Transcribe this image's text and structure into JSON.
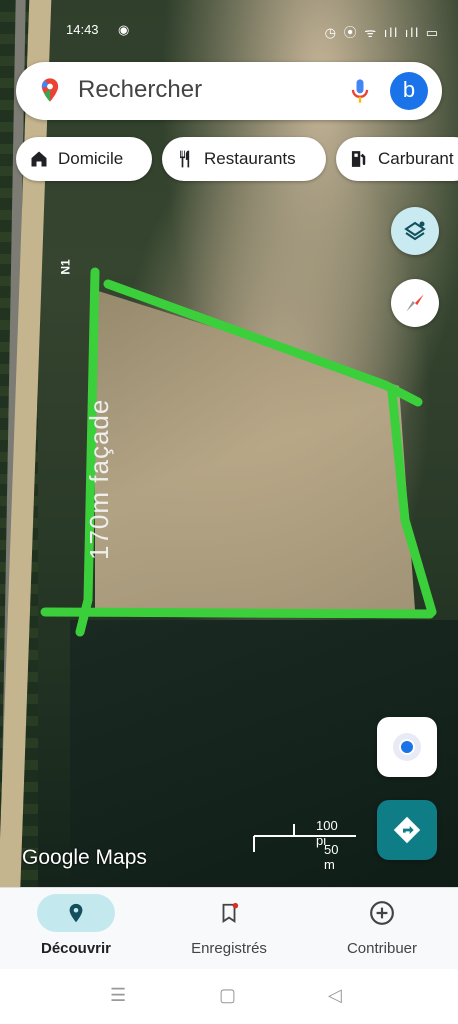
{
  "status_bar": {
    "time": "14:43",
    "messenger_icon": "messenger-icon",
    "right_icons": "◷ ⦿ ᯤ ıll ıll ▭"
  },
  "search": {
    "placeholder": "Rechercher",
    "avatar_letter": "b"
  },
  "chips": [
    {
      "label": "Domicile",
      "icon": "home-icon"
    },
    {
      "label": "Restaurants",
      "icon": "restaurant-icon"
    },
    {
      "label": "Carburant",
      "icon": "gas-station-icon"
    }
  ],
  "map": {
    "road_label": "N1",
    "annotation": "170m façade",
    "scale_imperial": "100 pi",
    "scale_metric": "50 m",
    "logo": "Google Maps"
  },
  "bottom_nav": [
    {
      "label": "Découvrir",
      "icon": "explore-pin-icon",
      "active": true
    },
    {
      "label": "Enregistrés",
      "icon": "bookmark-icon",
      "active": false
    },
    {
      "label": "Contribuer",
      "icon": "add-circle-icon",
      "active": false
    }
  ],
  "colors": {
    "accent": "#1a73e8",
    "fab_dark": "#0f7d86",
    "annotation_green": "#3ccf3c",
    "nav_active_bg": "#c3e9ef"
  }
}
